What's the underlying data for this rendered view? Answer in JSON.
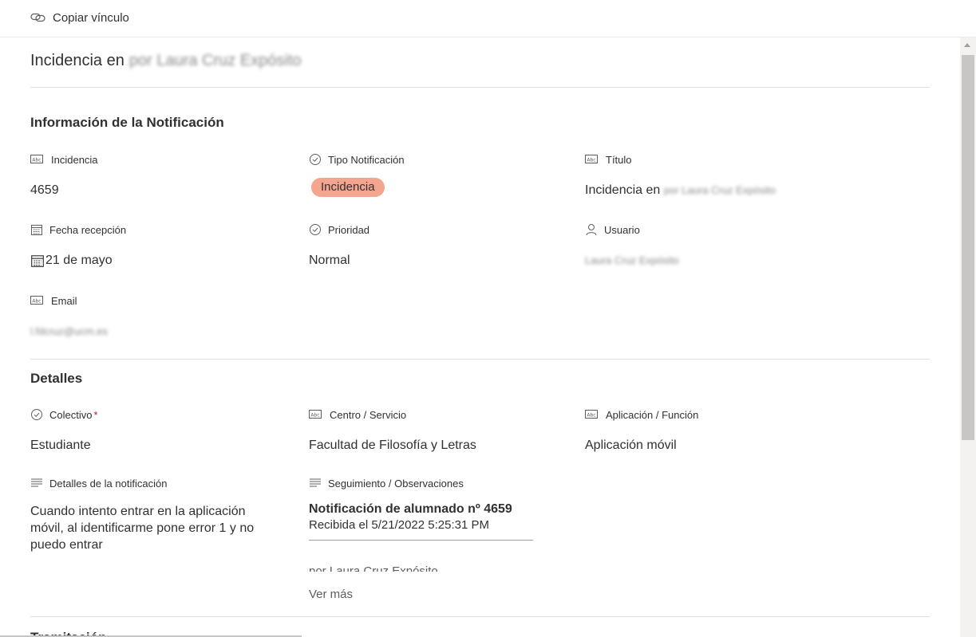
{
  "toolbar": {
    "copy_link_label": "Copiar vínculo"
  },
  "title": {
    "prefix": "Incidencia en",
    "redacted": "por Laura Cruz Expósito"
  },
  "sections": {
    "info": {
      "title": "Información de la Notificación",
      "incidencia": {
        "label": "Incidencia",
        "value": "4659",
        "icon": "text-field-icon"
      },
      "tipo": {
        "label": "Tipo Notificación",
        "value": "Incidencia",
        "color": "#f4a58f",
        "icon": "choice-check-icon"
      },
      "titulo": {
        "label": "Título",
        "value_prefix": "Incidencia en",
        "value_redacted": "por Laura Cruz Expósito",
        "icon": "text-field-icon"
      },
      "fecha": {
        "label": "Fecha recepción",
        "value": "21 de mayo",
        "icon": "calendar-icon"
      },
      "prioridad": {
        "label": "Prioridad",
        "value": "Normal",
        "icon": "choice-check-icon"
      },
      "usuario": {
        "label": "Usuario",
        "value_redacted": "Laura Cruz Expósito",
        "icon": "person-icon"
      },
      "email": {
        "label": "Email",
        "value_redacted": "l.fdcruz@ucm.es",
        "icon": "text-field-icon"
      }
    },
    "details": {
      "title": "Detalles",
      "colectivo": {
        "label": "Colectivo",
        "required": "*",
        "value": "Estudiante",
        "icon": "choice-check-icon"
      },
      "centro": {
        "label": "Centro / Servicio",
        "value": "Facultad de Filosofía y Letras",
        "icon": "text-field-icon"
      },
      "aplicacion": {
        "label": "Aplicación / Función",
        "value": "Aplicación móvil",
        "icon": "text-field-icon"
      },
      "detalles": {
        "label": "Detalles de la notificación",
        "value": "Cuando intento entrar en la aplicación móvil, al identificarme pone error 1 y no puedo entrar",
        "icon": "multiline-text-icon"
      },
      "seguimiento": {
        "label": "Seguimiento / Observaciones",
        "entry_title": "Notificación de alumnado nº 4659",
        "entry_received": "Recibida el 5/21/2022 5:25:31 PM",
        "entry_cut": "por Laura Cruz Expósito",
        "more_label": "Ver más",
        "icon": "multiline-text-icon"
      }
    },
    "tramitacion": {
      "title": "Tramitación"
    }
  }
}
